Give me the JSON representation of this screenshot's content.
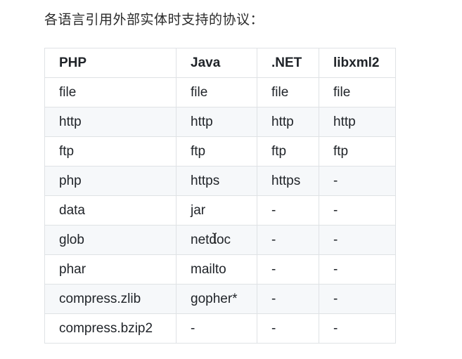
{
  "heading": "各语言引用外部实体时支持的协议：",
  "table": {
    "headers": [
      "PHP",
      "Java",
      ".NET",
      "libxml2"
    ],
    "rows": [
      [
        "file",
        "file",
        "file",
        "file"
      ],
      [
        "http",
        "http",
        "http",
        "http"
      ],
      [
        "ftp",
        "ftp",
        "ftp",
        "ftp"
      ],
      [
        "php",
        "https",
        "https",
        "-"
      ],
      [
        "data",
        "jar",
        "-",
        "-"
      ],
      [
        "glob",
        "netdoc",
        "-",
        "-"
      ],
      [
        "phar",
        "mailto",
        "-",
        "-"
      ],
      [
        "compress.zlib",
        "gopher*",
        "-",
        "-"
      ],
      [
        "compress.bzip2",
        "-",
        "-",
        "-"
      ]
    ]
  },
  "icons": {
    "cursor": "text-cursor-icon"
  }
}
